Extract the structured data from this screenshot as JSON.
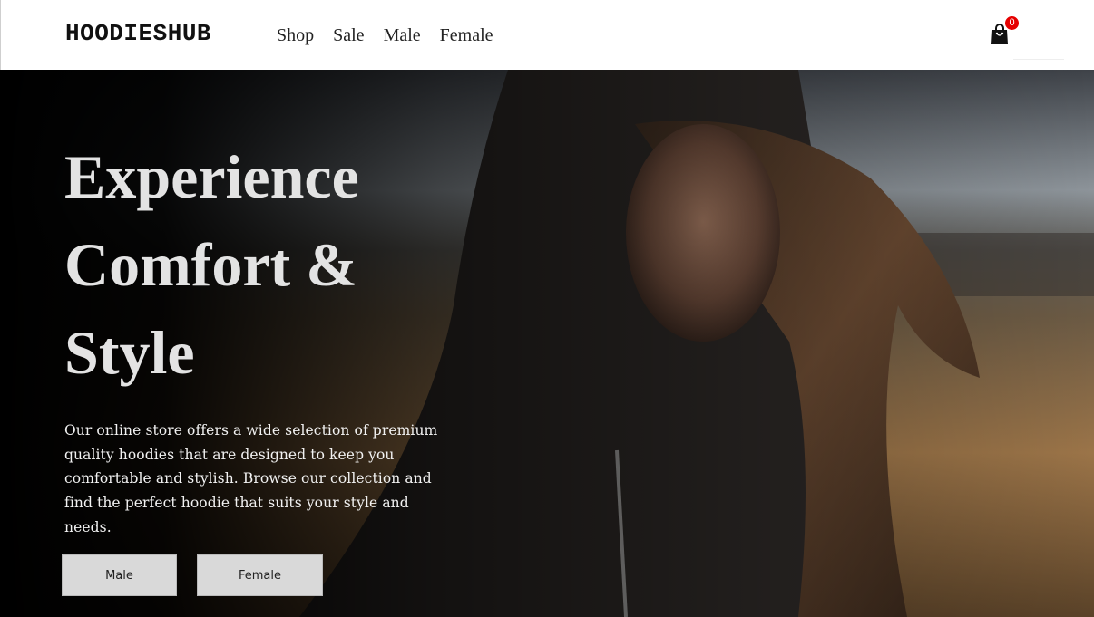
{
  "brand": {
    "name": "HOODIESHUB"
  },
  "nav": {
    "items": [
      {
        "label": "Shop"
      },
      {
        "label": "Sale"
      },
      {
        "label": "Male"
      },
      {
        "label": "Female"
      }
    ]
  },
  "cart": {
    "icon": "shopping-bag-icon",
    "count": "0",
    "badge_color": "#e60000"
  },
  "hero": {
    "title_lines": [
      "Experience",
      "Comfort &",
      "Style"
    ],
    "description": "Our online store offers a wide selection of premium quality hoodies that are designed to keep you comfortable and stylish. Browse our collection and find the perfect hoodie that suits your style and needs.",
    "buttons": {
      "male_label": "Male",
      "female_label": "Female"
    },
    "background_image": "woman-in-dark-hoodie-in-field"
  },
  "colors": {
    "title": "#e3e3e3",
    "button_bg": "#d9d9d9",
    "header_bg": "#ffffff"
  }
}
